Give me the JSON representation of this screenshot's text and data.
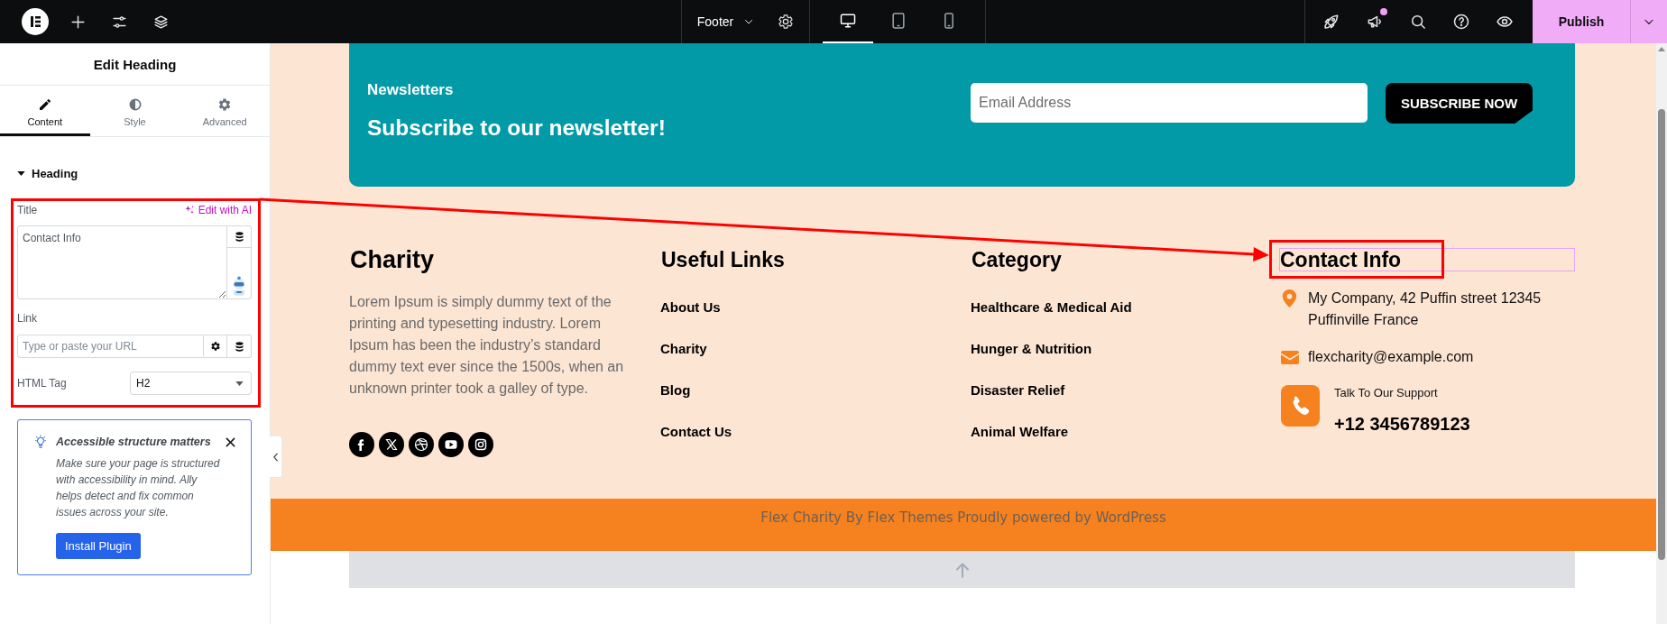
{
  "top_bar": {
    "document_title": "Footer",
    "notifications": true,
    "devices": [
      {
        "selected": true
      },
      {
        "selected": false
      },
      {
        "selected": false
      }
    ],
    "publish": "Publish"
  },
  "panel": {
    "title": "Edit Heading",
    "tabs": [
      {
        "label": "Content",
        "selected": true
      },
      {
        "label": "Style",
        "selected": false
      },
      {
        "label": "Advanced",
        "selected": false
      }
    ],
    "section": {
      "label": "Heading",
      "expanded": true
    },
    "title_field": {
      "label": "Title",
      "ai_action": "Edit with AI",
      "value": "Contact Info"
    },
    "link_field": {
      "label": "Link",
      "placeholder": "Type or paste your URL"
    },
    "html_tag": {
      "label": "HTML Tag",
      "value": "H2"
    },
    "notice": {
      "title": "Accessible structure matters",
      "text": "Make sure your page is structured with accessibility in mind. Ally helps detect and fix common issues across your site.",
      "button": "Install Plugin"
    }
  },
  "canvas": {
    "newsletter": {
      "label": "Newsletters",
      "heading": "Subscribe to our newsletter!",
      "email_placeholder": "Email Address",
      "button": "SUBSCRIBE NOW"
    },
    "columns": [
      {
        "kind": "about",
        "heading": "Charity",
        "selected": false,
        "text": "Lorem Ipsum is simply dummy text of the printing and typesetting industry. Lorem Ipsum has been the industry’s standard dummy text ever since the 1500s, when an unknown printer took a galley of type."
      },
      {
        "kind": "links",
        "heading": "Useful Links",
        "selected": false,
        "links": [
          "About Us",
          "Charity",
          "Blog",
          "Contact Us"
        ]
      },
      {
        "kind": "links",
        "heading": "Category",
        "selected": false,
        "links": [
          "Healthcare & Medical Aid",
          "Hunger & Nutrition",
          "Disaster Relief",
          "Animal Welfare"
        ]
      },
      {
        "kind": "contact",
        "heading": "Contact Info",
        "selected": true,
        "address": "My Company, 42 Puffin street 12345 Puffinville France",
        "email": "flexcharity@example.com",
        "support_label": "Talk To Our Support",
        "phone": "+12 3456789123"
      }
    ],
    "copyright": "Flex Charity By Flex Themes Proudly powered by WordPress"
  }
}
